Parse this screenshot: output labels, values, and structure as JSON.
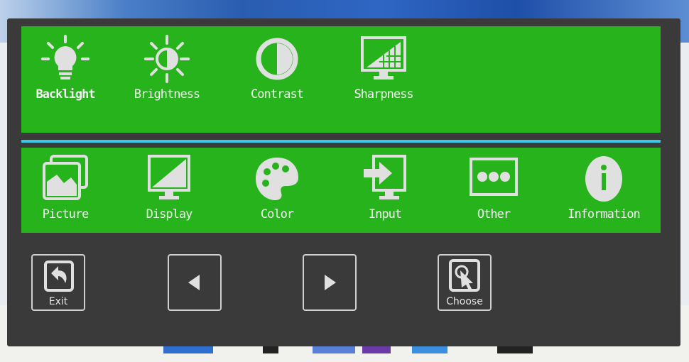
{
  "menu_top": [
    {
      "id": "backlight",
      "label": "Backlight",
      "icon": "lightbulb-icon",
      "selected": true
    },
    {
      "id": "brightness",
      "label": "Brightness",
      "icon": "sun-icon",
      "selected": false
    },
    {
      "id": "contrast",
      "label": "Contrast",
      "icon": "contrast-icon",
      "selected": false
    },
    {
      "id": "sharpness",
      "label": "Sharpness",
      "icon": "sharpness-monitor-icon",
      "selected": false
    }
  ],
  "menu_bottom": [
    {
      "id": "picture",
      "label": "Picture",
      "icon": "picture-icon"
    },
    {
      "id": "display",
      "label": "Display",
      "icon": "display-monitor-icon"
    },
    {
      "id": "color",
      "label": "Color",
      "icon": "palette-icon"
    },
    {
      "id": "input",
      "label": "Input",
      "icon": "input-arrow-icon"
    },
    {
      "id": "other",
      "label": "Other",
      "icon": "dots-icon"
    },
    {
      "id": "information",
      "label": "Information",
      "icon": "info-icon"
    }
  ],
  "buttons": {
    "exit": {
      "label": "Exit",
      "icon": "return-icon"
    },
    "left": {
      "label": "",
      "icon": "left-arrow-icon"
    },
    "right": {
      "label": "",
      "icon": "right-arrow-icon"
    },
    "choose": {
      "label": "Choose",
      "icon": "touch-icon"
    }
  },
  "colors": {
    "panel_green": "#27b31b",
    "separator_blue": "#3cc6e8",
    "frame": "#3a3a3a",
    "icon_fill": "#e0e0e0"
  }
}
